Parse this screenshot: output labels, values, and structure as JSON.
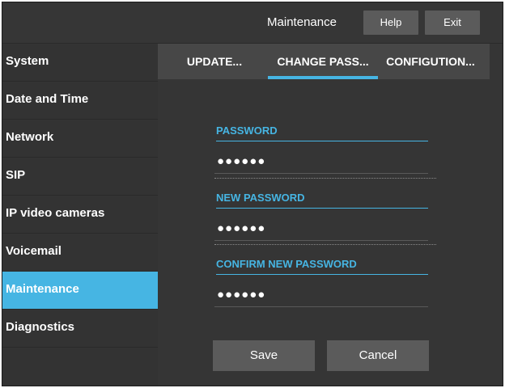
{
  "header": {
    "title": "Maintenance",
    "help_label": "Help",
    "exit_label": "Exit"
  },
  "sidebar": {
    "items": [
      {
        "label": "System"
      },
      {
        "label": "Date and Time"
      },
      {
        "label": "Network"
      },
      {
        "label": "SIP"
      },
      {
        "label": "IP video cameras"
      },
      {
        "label": "Voicemail"
      },
      {
        "label": "Maintenance",
        "active": true
      },
      {
        "label": "Diagnostics"
      }
    ]
  },
  "tabs": [
    {
      "label": "UPDATE..."
    },
    {
      "label": "CHANGE PASS...",
      "active": true
    },
    {
      "label": "CONFIGUTION..."
    }
  ],
  "form": {
    "password_label": "PASSWORD",
    "password_value": "●●●●●●",
    "new_password_label": "NEW PASSWORD",
    "new_password_value": "●●●●●●",
    "confirm_label": "CONFIRM NEW PASSWORD",
    "confirm_value": "●●●●●●"
  },
  "buttons": {
    "save_label": "Save",
    "cancel_label": "Cancel"
  },
  "colors": {
    "accent": "#46b5e3",
    "background": "#353535",
    "button": "#5b5b5b"
  }
}
